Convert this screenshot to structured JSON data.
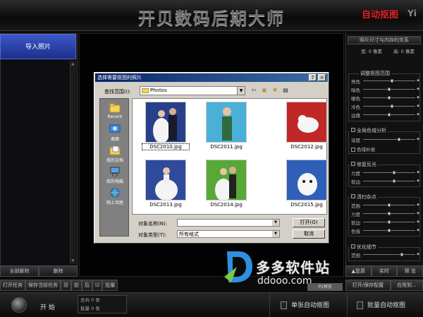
{
  "app": {
    "title": "开贝数码后期大师",
    "mode_logo": "自动抠图",
    "brand_mark": "Yi"
  },
  "left_panel": {
    "header": "导入照片",
    "btn_clear_all": "全部删除",
    "btn_delete": "删除",
    "task_buttons": [
      "打开任务",
      "保存当前任务",
      "另",
      "前",
      "后",
      "☑",
      "批量"
    ]
  },
  "dialog": {
    "title": "选择需要抠图的照片",
    "help_btn": "?",
    "close_btn": "×",
    "lookin_label": "查找范围(I):",
    "lookin_value": "Photos",
    "places": [
      "Recent",
      "桌面",
      "我的文档",
      "我的电脑",
      "网上邻居"
    ],
    "files": [
      {
        "name": "DSC2010.jpg",
        "selected": true
      },
      {
        "name": "DSC2011.jpg",
        "selected": false
      },
      {
        "name": "DSC2012.jpg",
        "selected": false
      },
      {
        "name": "DSC2013.jpg",
        "selected": false
      },
      {
        "name": "DSC2014.jpg",
        "selected": false
      },
      {
        "name": "DSC2015.jpg",
        "selected": false
      }
    ],
    "filename_label": "对象名称(N):",
    "filename_value": "",
    "filetype_label": "对象类型(T):",
    "filetype_value": "所有格式",
    "open_btn": "打开(O)",
    "cancel_btn": "取消"
  },
  "right_panel": {
    "size_header": "照片尺寸与内存的关系",
    "width_text": "宽: 0 像素",
    "height_text": "高: 0 像素",
    "adjust_title": "调整抠图范围",
    "adjust_sliders": [
      {
        "label": "亮色",
        "value": 0.55
      },
      {
        "label": "暗色",
        "value": 0.5
      },
      {
        "label": "暖色",
        "value": 0.5
      },
      {
        "label": "冷色",
        "value": 0.55
      },
      {
        "label": "边缘",
        "value": 0.5
      }
    ],
    "global_title": "全局色域分析",
    "global_sliders": [
      {
        "label": "深度",
        "value": 0.7
      }
    ],
    "global_check": "色域补偿",
    "repair_title": "修复反光",
    "repair_sliders": [
      {
        "label": "力度",
        "value": 0.6
      },
      {
        "label": "软边",
        "value": 0.6
      }
    ],
    "clean_title": "清扫杂点",
    "clean_sliders": [
      {
        "label": "范围",
        "value": 0.5
      },
      {
        "label": "力度",
        "value": 0.5
      },
      {
        "label": "软边",
        "value": 0.5
      },
      {
        "label": "色值",
        "value": 0.5
      }
    ],
    "opt_title": "优化细节",
    "opt_sliders": [
      {
        "label": "范围",
        "value": 0.75
      }
    ],
    "btn_restore": "▲复原",
    "btn_realtime": "实时",
    "btn_preview": "预 览",
    "btn_open_save": "打开/保存配置",
    "btn_apply": "应用到..."
  },
  "bottom": {
    "start": "开  始",
    "total": "总共 0 张",
    "batch": "批量 0 张",
    "single_auto": "单张自动抠图",
    "batch_auto": "批量自动抠图"
  },
  "watermark": {
    "text": "多多软件站",
    "url": "ddooo.com",
    "tag": "PS预览"
  },
  "colors": {
    "accent_blue": "#3c58c8",
    "logo_red": "#e02424",
    "dialog_bg": "#d4d0c8"
  }
}
